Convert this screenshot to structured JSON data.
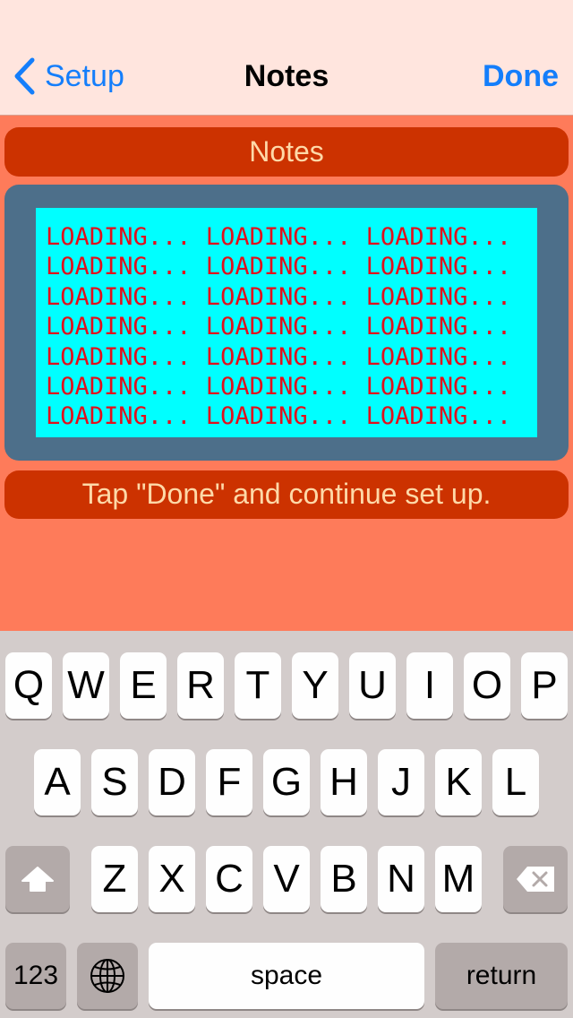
{
  "navbar": {
    "back_label": "Setup",
    "title": "Notes",
    "done_label": "Done"
  },
  "notes": {
    "header": "Notes",
    "content": "LOADING... LOADING... LOADING...\nLOADING... LOADING... LOADING...\nLOADING... LOADING... LOADING...\nLOADING... LOADING... LOADING...\nLOADING... LOADING... LOADING...\nLOADING... LOADING... LOADING...\nLOADING... LOADING... LOADING...",
    "footer": "Tap \"Done\" and continue set up."
  },
  "keyboard": {
    "row1": [
      "Q",
      "W",
      "E",
      "R",
      "T",
      "Y",
      "U",
      "I",
      "O",
      "P"
    ],
    "row2": [
      "A",
      "S",
      "D",
      "F",
      "G",
      "H",
      "J",
      "K",
      "L"
    ],
    "row3": [
      "Z",
      "X",
      "C",
      "V",
      "B",
      "N",
      "M"
    ],
    "numbers_label": "123",
    "space_label": "space",
    "return_label": "return",
    "shift_icon": "shift-icon",
    "delete_icon": "delete-icon",
    "globe_icon": "globe-icon"
  },
  "colors": {
    "nav_background": "#ffe5de",
    "tint": "#147efb",
    "page_background": "#fe7b5a",
    "pill_background": "#cc3200",
    "pill_text": "#ffd9a8",
    "frame": "#4d6f8a",
    "text_area": "#00ffff",
    "text_color": "#e0101c"
  }
}
